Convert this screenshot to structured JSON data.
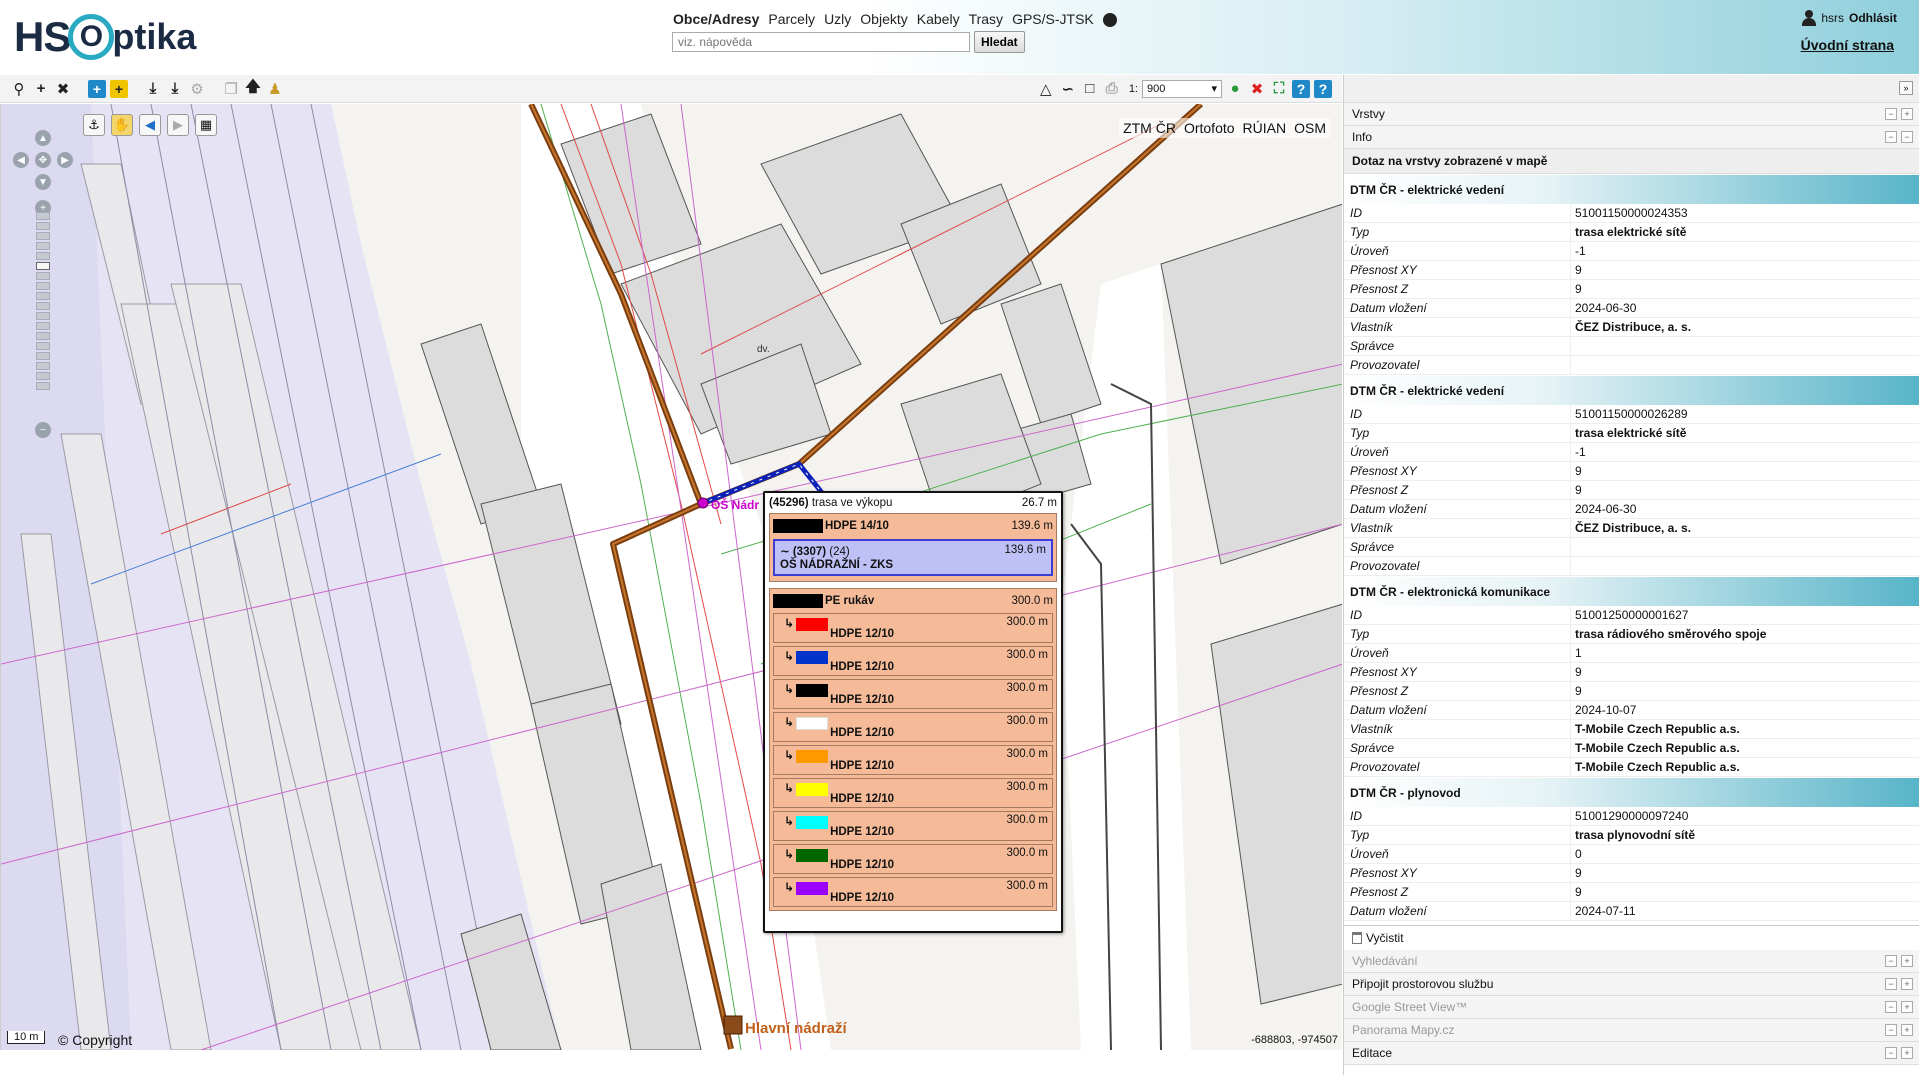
{
  "header": {
    "logo_hs": "HS",
    "logo_o": "O",
    "logo_ptika": "ptika",
    "search_tabs": [
      "Obce/Adresy",
      "Parcely",
      "Uzly",
      "Objekty",
      "Kabely",
      "Trasy",
      "GPS/S-JTSK"
    ],
    "search_placeholder": "viz. nápověda",
    "search_button": "Hledat",
    "user_name": "hsrs",
    "logout": "Odhlásit",
    "home_link": "Úvodní strana"
  },
  "toolbar": {
    "scale_prefix": "1:",
    "scale_value": "900"
  },
  "map": {
    "basemaps": [
      "ZTM ČR",
      "Ortofoto",
      "RÚIAN",
      "OSM"
    ],
    "scalebar": "10 m",
    "copyright": "© Copyright",
    "coords": "-688803, -974507",
    "labels": {
      "node": "OŠ Nádr",
      "station": "Hlavní nádraží",
      "dv": "dv."
    }
  },
  "popup": {
    "route_id": "(45296)",
    "route_type": "trasa ve výkopu",
    "route_len": "26.7 m",
    "groups": [
      {
        "name": "HDPE 14/10",
        "len": "139.6 m",
        "color": "#000000",
        "cable": {
          "id": "(3307)",
          "count": "(24)",
          "name": "OŠ NÁDRAŽNÍ - ZKS",
          "len": "139.6 m"
        }
      },
      {
        "name": "PE rukáv",
        "len": "300.0 m",
        "color": "#000000",
        "tubes": [
          {
            "name": "HDPE 12/10",
            "len": "300.0 m",
            "color": "#ff0000"
          },
          {
            "name": "HDPE 12/10",
            "len": "300.0 m",
            "color": "#0033cc"
          },
          {
            "name": "HDPE 12/10",
            "len": "300.0 m",
            "color": "#000000"
          },
          {
            "name": "HDPE 12/10",
            "len": "300.0 m",
            "color": "#ffffff"
          },
          {
            "name": "HDPE 12/10",
            "len": "300.0 m",
            "color": "#ff9900"
          },
          {
            "name": "HDPE 12/10",
            "len": "300.0 m",
            "color": "#ffff00"
          },
          {
            "name": "HDPE 12/10",
            "len": "300.0 m",
            "color": "#00ffff"
          },
          {
            "name": "HDPE 12/10",
            "len": "300.0 m",
            "color": "#006600"
          },
          {
            "name": "HDPE 12/10",
            "len": "300.0 m",
            "color": "#9900ff"
          }
        ]
      }
    ]
  },
  "panel": {
    "sections_top": [
      "Vrstvy",
      "Info"
    ],
    "query_title": "Dotaz na vrstvy zobrazené v mapě",
    "layers": [
      {
        "title": "DTM ČR - elektrické vedení",
        "attrs": [
          {
            "k": "ID",
            "v": "51001150000024353",
            "b": false
          },
          {
            "k": "Typ",
            "v": "trasa elektrické sítě",
            "b": true
          },
          {
            "k": "Úroveň",
            "v": "-1",
            "b": false
          },
          {
            "k": "Přesnost XY",
            "v": "9",
            "b": false
          },
          {
            "k": "Přesnost Z",
            "v": "9",
            "b": false
          },
          {
            "k": "Datum vložení",
            "v": "2024-06-30",
            "b": false
          },
          {
            "k": "Vlastník",
            "v": "ČEZ Distribuce, a. s.",
            "b": true
          },
          {
            "k": "Správce",
            "v": "",
            "b": false
          },
          {
            "k": "Provozovatel",
            "v": "",
            "b": false
          }
        ]
      },
      {
        "title": "DTM ČR - elektrické vedení",
        "attrs": [
          {
            "k": "ID",
            "v": "51001150000026289",
            "b": false
          },
          {
            "k": "Typ",
            "v": "trasa elektrické sítě",
            "b": true
          },
          {
            "k": "Úroveň",
            "v": "-1",
            "b": false
          },
          {
            "k": "Přesnost XY",
            "v": "9",
            "b": false
          },
          {
            "k": "Přesnost Z",
            "v": "9",
            "b": false
          },
          {
            "k": "Datum vložení",
            "v": "2024-06-30",
            "b": false
          },
          {
            "k": "Vlastník",
            "v": "ČEZ Distribuce, a. s.",
            "b": true
          },
          {
            "k": "Správce",
            "v": "",
            "b": false
          },
          {
            "k": "Provozovatel",
            "v": "",
            "b": false
          }
        ]
      },
      {
        "title": "DTM ČR - elektronická komunikace",
        "attrs": [
          {
            "k": "ID",
            "v": "51001250000001627",
            "b": false
          },
          {
            "k": "Typ",
            "v": "trasa rádiového směrového spoje",
            "b": true
          },
          {
            "k": "Úroveň",
            "v": "1",
            "b": false
          },
          {
            "k": "Přesnost XY",
            "v": "9",
            "b": false
          },
          {
            "k": "Přesnost Z",
            "v": "9",
            "b": false
          },
          {
            "k": "Datum vložení",
            "v": "2024-10-07",
            "b": false
          },
          {
            "k": "Vlastník",
            "v": "T-Mobile Czech Republic a.s.",
            "b": true
          },
          {
            "k": "Správce",
            "v": "T-Mobile Czech Republic a.s.",
            "b": true
          },
          {
            "k": "Provozovatel",
            "v": "T-Mobile Czech Republic a.s.",
            "b": true
          }
        ]
      },
      {
        "title": "DTM ČR - plynovod",
        "attrs": [
          {
            "k": "ID",
            "v": "51001290000097240",
            "b": false
          },
          {
            "k": "Typ",
            "v": "trasa plynovodní sítě",
            "b": true
          },
          {
            "k": "Úroveň",
            "v": "0",
            "b": false
          },
          {
            "k": "Přesnost XY",
            "v": "9",
            "b": false
          },
          {
            "k": "Přesnost Z",
            "v": "9",
            "b": false
          },
          {
            "k": "Datum vložení",
            "v": "2024-07-11",
            "b": false
          }
        ]
      }
    ],
    "clear": "Vyčistit",
    "sections_bottom": [
      {
        "label": "Vyhledávání",
        "dim": true
      },
      {
        "label": "Připojit prostorovou službu",
        "dim": false
      },
      {
        "label": "Google Street View™",
        "dim": true
      },
      {
        "label": "Panorama Mapy.cz",
        "dim": true
      },
      {
        "label": "Editace",
        "dim": false
      }
    ]
  }
}
